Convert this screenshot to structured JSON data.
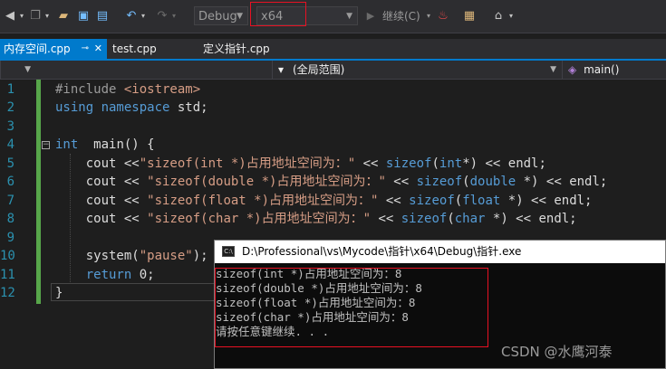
{
  "toolbar": {
    "configuration": "Debug",
    "platform": "x64",
    "continue_label": "继续(C)",
    "icons": [
      "back-icon",
      "forward-icon",
      "new-project-icon",
      "open-file-icon",
      "save-icon",
      "save-all-icon",
      "undo-icon",
      "redo-icon",
      "play-icon",
      "hot-reload-icon",
      "solution-explorer-icon",
      "screenshot-icon"
    ]
  },
  "tabs": [
    {
      "label": "内存空间.cpp",
      "active": true
    },
    {
      "label": "test.cpp",
      "active": false
    },
    {
      "label": "定义指针.cpp",
      "active": false
    }
  ],
  "navbar": {
    "scope": "(全局范围)",
    "function": "main()"
  },
  "editor": {
    "line_numbers": [
      "1",
      "2",
      "3",
      "4",
      "5",
      "6",
      "7",
      "8",
      "9",
      "10",
      "11",
      "12"
    ],
    "lines": [
      {
        "a": "#include ",
        "b": "<iostream>"
      },
      {
        "a": "using namespace",
        "b": " std;"
      },
      {
        "a": "",
        "b": ""
      },
      {
        "a": "int",
        "b": "  main() {"
      },
      {
        "a": "    cout <<",
        "b": "\"sizeof(int *)占用地址空间为：\"",
        "c": " << ",
        "d": "sizeof",
        "e": "(",
        "f": "int",
        "g": "*) << endl;"
      },
      {
        "a": "    cout << ",
        "b": "\"sizeof(double *)占用地址空间为：\"",
        "c": " << ",
        "d": "sizeof",
        "e": "(",
        "f": "double",
        "g": " *) << endl;"
      },
      {
        "a": "    cout << ",
        "b": "\"sizeof(float *)占用地址空间为：\"",
        "c": " << ",
        "d": "sizeof",
        "e": "(",
        "f": "float",
        "g": " *) << endl;"
      },
      {
        "a": "    cout << ",
        "b": "\"sizeof(char *)占用地址空间为：\"",
        "c": " << ",
        "d": "sizeof",
        "e": "(",
        "f": "char",
        "g": " *) << endl;"
      },
      {
        "a": "",
        "b": ""
      },
      {
        "a": "    system(",
        "b": "\"pause\"",
        "c": ");"
      },
      {
        "a": "    ",
        "b": "return",
        "c": " 0;"
      },
      {
        "a": "}",
        "b": ""
      }
    ]
  },
  "console": {
    "title": "D:\\Professional\\vs\\Mycode\\指针\\x64\\Debug\\指针.exe",
    "icon_text": "C:\\",
    "lines": [
      "sizeof(int *)占用地址空间为：8",
      "sizeof(double *)占用地址空间为：8",
      "sizeof(float *)占用地址空间为：8",
      "sizeof(char *)占用地址空间为：8",
      "请按任意键继续. . ."
    ]
  },
  "watermark": "CSDN @水鹰河泰",
  "colors": {
    "accent": "#007acc",
    "highlight_box": "#e81123",
    "change_bar": "#57a64a",
    "keyword": "#569cd6",
    "string": "#d69d85"
  }
}
